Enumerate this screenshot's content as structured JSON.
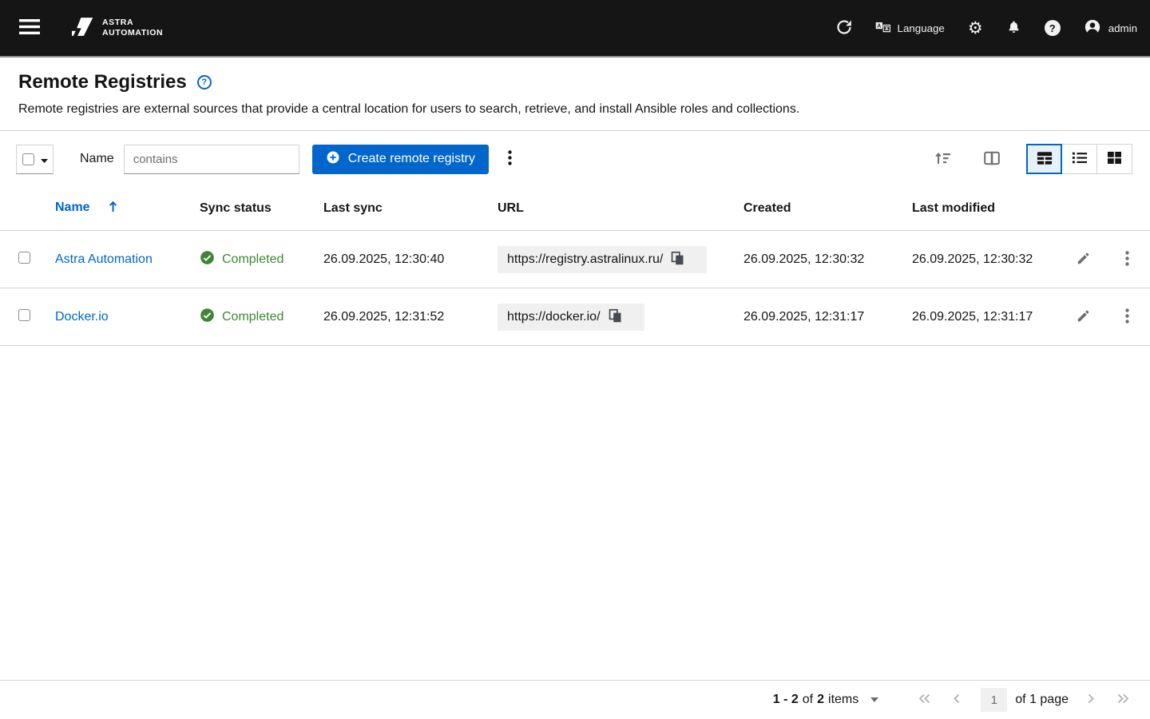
{
  "topbar": {
    "brand_line1": "ASTRA",
    "brand_line2": "AUTOMATION",
    "language_label": "Language",
    "username": "admin"
  },
  "page_header": {
    "title": "Remote Registries",
    "description": "Remote registries are external sources that provide a central location for users to search, retrieve, and install Ansible roles and collections."
  },
  "toolbar": {
    "filter_field_label": "Name",
    "filter_placeholder": "contains",
    "create_button_label": "Create remote registry"
  },
  "table": {
    "columns": [
      "Name",
      "Sync status",
      "Last sync",
      "URL",
      "Created",
      "Last modified"
    ],
    "rows": [
      {
        "name": "Astra Automation",
        "sync_status": "Completed",
        "last_sync": "26.09.2025, 12:30:40",
        "url": "https://registry.astralinux.ru/",
        "created": "26.09.2025, 12:30:32",
        "last_modified": "26.09.2025, 12:30:32"
      },
      {
        "name": "Docker.io",
        "sync_status": "Completed",
        "last_sync": "26.09.2025, 12:31:52",
        "url": "https://docker.io/",
        "created": "26.09.2025, 12:31:17",
        "last_modified": "26.09.2025, 12:31:17"
      }
    ]
  },
  "pagination": {
    "range": "1 - 2",
    "of_word": "of",
    "total": "2",
    "items_word": "items",
    "page_value": "1",
    "page_of_label": "of 1 page"
  },
  "icons": {
    "gear": "⚙",
    "help_mark": "?",
    "lang_letter": "A"
  },
  "colors": {
    "topbar_bg": "#151515",
    "accent": "#0066CC",
    "success": "#3E8635",
    "border": "#D2D2D2",
    "pill_bg": "#F0F0F0"
  }
}
